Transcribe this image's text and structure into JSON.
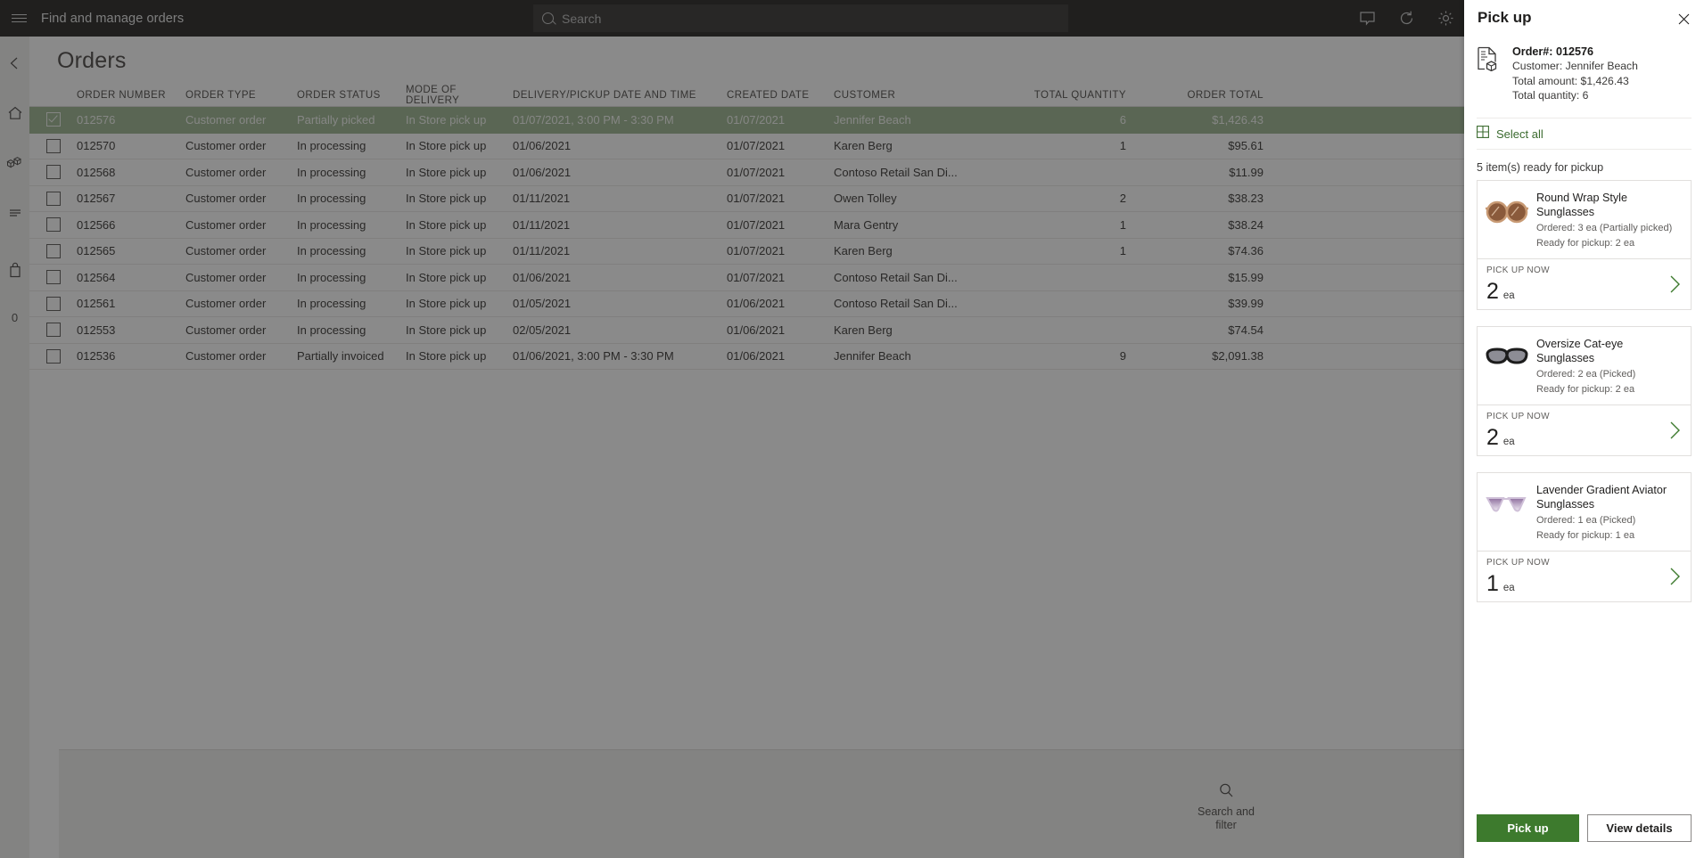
{
  "topbar": {
    "menu_icon": "hamburger-icon",
    "app_title": "Find and manage orders",
    "search_placeholder": "Search",
    "search_value": "",
    "icons": [
      "comment-icon",
      "refresh-icon",
      "gear-icon"
    ]
  },
  "leftrail": {
    "items": [
      {
        "icon": "back-arrow-icon",
        "name": "back"
      },
      {
        "icon": "home-icon",
        "name": "home"
      },
      {
        "icon": "products-icon",
        "name": "products"
      },
      {
        "icon": "list-icon",
        "name": "list"
      },
      {
        "icon": "bag-icon",
        "name": "bag"
      }
    ],
    "badge": "0"
  },
  "page": {
    "title": "Orders"
  },
  "table": {
    "columns": [
      "ORDER NUMBER",
      "ORDER TYPE",
      "ORDER STATUS",
      "MODE OF DELIVERY",
      "DELIVERY/PICKUP DATE AND TIME",
      "CREATED DATE",
      "CUSTOMER",
      "TOTAL QUANTITY",
      "ORDER TOTAL"
    ],
    "rows": [
      {
        "selected": true,
        "order_number": "012576",
        "order_type": "Customer order",
        "order_status": "Partially picked",
        "mode_of_delivery": "In Store pick up",
        "delivery_datetime": "01/07/2021, 3:00 PM - 3:30 PM",
        "created_date": "01/07/2021",
        "customer": "Jennifer Beach",
        "total_quantity": "6",
        "order_total": "$1,426.43"
      },
      {
        "selected": false,
        "order_number": "012570",
        "order_type": "Customer order",
        "order_status": "In processing",
        "mode_of_delivery": "In Store pick up",
        "delivery_datetime": "01/06/2021",
        "created_date": "01/07/2021",
        "customer": "Karen Berg",
        "total_quantity": "1",
        "order_total": "$95.61"
      },
      {
        "selected": false,
        "order_number": "012568",
        "order_type": "Customer order",
        "order_status": "In processing",
        "mode_of_delivery": "In Store pick up",
        "delivery_datetime": "01/06/2021",
        "created_date": "01/07/2021",
        "customer": "Contoso Retail San Di...",
        "total_quantity": "",
        "order_total": "$11.99"
      },
      {
        "selected": false,
        "order_number": "012567",
        "order_type": "Customer order",
        "order_status": "In processing",
        "mode_of_delivery": "In Store pick up",
        "delivery_datetime": "01/11/2021",
        "created_date": "01/07/2021",
        "customer": "Owen Tolley",
        "total_quantity": "2",
        "order_total": "$38.23"
      },
      {
        "selected": false,
        "order_number": "012566",
        "order_type": "Customer order",
        "order_status": "In processing",
        "mode_of_delivery": "In Store pick up",
        "delivery_datetime": "01/11/2021",
        "created_date": "01/07/2021",
        "customer": "Mara Gentry",
        "total_quantity": "1",
        "order_total": "$38.24"
      },
      {
        "selected": false,
        "order_number": "012565",
        "order_type": "Customer order",
        "order_status": "In processing",
        "mode_of_delivery": "In Store pick up",
        "delivery_datetime": "01/11/2021",
        "created_date": "01/07/2021",
        "customer": "Karen Berg",
        "total_quantity": "1",
        "order_total": "$74.36"
      },
      {
        "selected": false,
        "order_number": "012564",
        "order_type": "Customer order",
        "order_status": "In processing",
        "mode_of_delivery": "In Store pick up",
        "delivery_datetime": "01/06/2021",
        "created_date": "01/07/2021",
        "customer": "Contoso Retail San Di...",
        "total_quantity": "",
        "order_total": "$15.99"
      },
      {
        "selected": false,
        "order_number": "012561",
        "order_type": "Customer order",
        "order_status": "In processing",
        "mode_of_delivery": "In Store pick up",
        "delivery_datetime": "01/05/2021",
        "created_date": "01/06/2021",
        "customer": "Contoso Retail San Di...",
        "total_quantity": "",
        "order_total": "$39.99"
      },
      {
        "selected": false,
        "order_number": "012553",
        "order_type": "Customer order",
        "order_status": "In processing",
        "mode_of_delivery": "In Store pick up",
        "delivery_datetime": "02/05/2021",
        "created_date": "01/06/2021",
        "customer": "Karen Berg",
        "total_quantity": "",
        "order_total": "$74.54"
      },
      {
        "selected": false,
        "order_number": "012536",
        "order_type": "Customer order",
        "order_status": "Partially invoiced",
        "mode_of_delivery": "In Store pick up",
        "delivery_datetime": "01/06/2021, 3:00 PM - 3:30 PM",
        "created_date": "01/06/2021",
        "customer": "Jennifer Beach",
        "total_quantity": "9",
        "order_total": "$2,091.38"
      }
    ]
  },
  "bottombar": {
    "commands": [
      {
        "icon": "search-icon",
        "label": "Search and filter"
      }
    ]
  },
  "panel": {
    "title": "Pick up",
    "close_icon": "close-icon",
    "order": {
      "icon": "order-document-icon",
      "order_number": "Order#: 012576",
      "customer": "Customer: Jennifer Beach",
      "total_amount": "Total amount: $1,426.43",
      "total_quantity": "Total quantity: 6"
    },
    "select_all": {
      "icon": "select-all-grid-icon",
      "label": "Select all"
    },
    "ready_count": "5 item(s) ready for pickup",
    "pickup_now_label": "PICK UP NOW",
    "items": [
      {
        "name": "Round Wrap Style Sunglasses",
        "ordered": "Ordered: 3 ea (Partially picked)",
        "ready": "Ready for pickup: 2 ea",
        "pickup_qty": "2",
        "unit": "ea",
        "thumb": "sunglasses-round-wrap-brown",
        "colors": {
          "lens": "#8a5a3b",
          "frame": "#c89a74"
        }
      },
      {
        "name": "Oversize Cat-eye Sunglasses",
        "ordered": "Ordered: 2 ea (Picked)",
        "ready": "Ready for pickup: 2 ea",
        "pickup_qty": "2",
        "unit": "ea",
        "thumb": "sunglasses-cateye-black",
        "colors": {
          "lens": "#8d8d95",
          "frame": "#1c1c1c"
        }
      },
      {
        "name": "Lavender Gradient Aviator Sunglasses",
        "ordered": "Ordered: 1 ea (Picked)",
        "ready": "Ready for pickup: 1 ea",
        "pickup_qty": "1",
        "unit": "ea",
        "thumb": "sunglasses-aviator-lavender",
        "colors": {
          "lens": "#8e6f9e",
          "frame": "#cfc0d8"
        }
      }
    ],
    "actions": {
      "pickup_label": "Pick up",
      "view_details_label": "View details"
    }
  },
  "theme": {
    "topbar_bg": "#3b3a39",
    "selected_row": "#5f7455",
    "accent_green": "#3d7a2d",
    "link_green": "#3b6b2f"
  }
}
